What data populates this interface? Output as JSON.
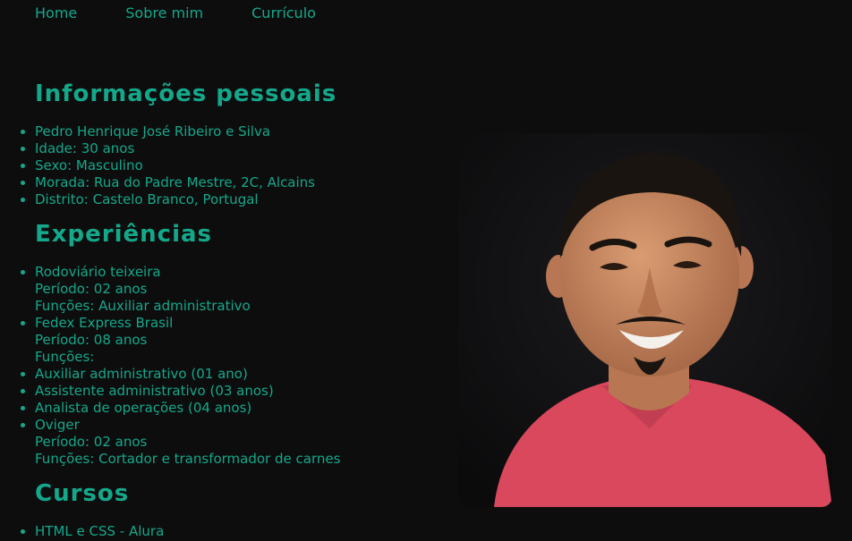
{
  "nav": {
    "items": [
      {
        "label": "Home"
      },
      {
        "label": "Sobre mim"
      },
      {
        "label": "Currículo"
      }
    ]
  },
  "personal": {
    "title": "Informações pessoais",
    "items": [
      "Pedro Henrique José Ribeiro e Silva",
      "Idade: 30 anos",
      "Sexo: Masculino",
      "Morada: Rua do Padre Mestre, 2C, Alcains",
      "Distrito: Castelo Branco, Portugal"
    ]
  },
  "experience": {
    "title": "Experiências",
    "items": [
      {
        "company": "Rodoviário teixeira",
        "lines": [
          "Período: 02 anos",
          "Funções: Auxiliar administrativo"
        ]
      },
      {
        "company": "Fedex Express Brasil",
        "lines": [
          "Período: 08 anos",
          "Funções:"
        ]
      },
      {
        "company": "Auxiliar administrativo (01 ano)",
        "lines": []
      },
      {
        "company": "Assistente administrativo (03 anos)",
        "lines": []
      },
      {
        "company": "Analista de operações (04 anos)",
        "lines": []
      },
      {
        "company": "Oviger",
        "lines": [
          "Período: 02 anos",
          "Funções: Cortador e transformador de carnes"
        ]
      }
    ]
  },
  "courses": {
    "title": "Cursos",
    "items": [
      "HTML e CSS - Alura"
    ]
  },
  "photo": {
    "icon": "profile-photo",
    "shirt_color": "#d9485c",
    "skin_color": "#c98a62",
    "hair_color": "#1a1410"
  },
  "colors": {
    "accent": "#14a88a",
    "background": "#0d0d0e"
  }
}
